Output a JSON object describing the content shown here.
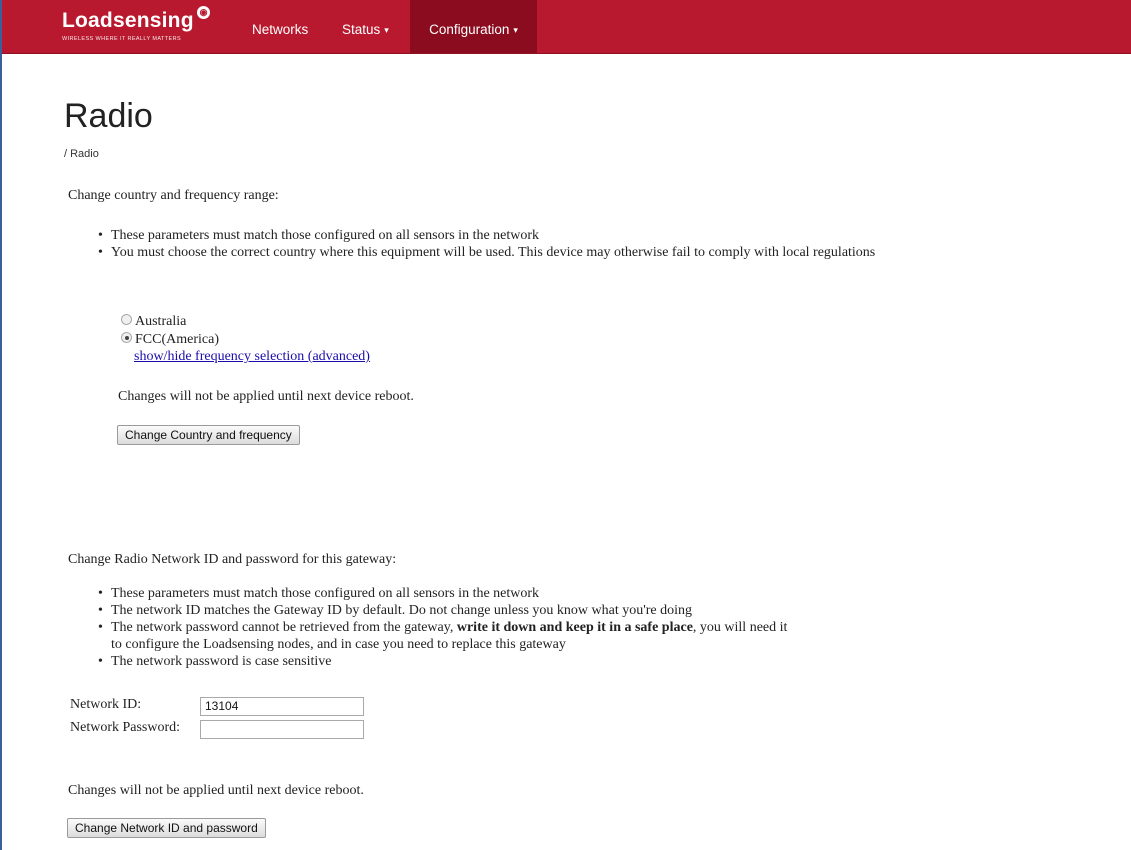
{
  "navbar": {
    "brand_name_bold": "Loadsensing",
    "brand_tagline": "WIRELESS WHERE IT REALLY MATTERS",
    "items": [
      {
        "label": "Networks",
        "has_caret": false,
        "active": false
      },
      {
        "label": "Status",
        "has_caret": true,
        "active": false
      },
      {
        "label": "Configuration",
        "has_caret": true,
        "active": true
      }
    ],
    "caret": "▾",
    "color": "#b8192f",
    "active_color": "#8b0c1f"
  },
  "page": {
    "title": "Radio",
    "breadcrumb": "/ Radio"
  },
  "country_section": {
    "heading": "Change country and frequency range:",
    "bullets": [
      "These parameters must match those configured on all sensors in the network",
      "You must choose the correct country where this equipment will be used. This device may otherwise fail to comply with local regulations"
    ],
    "options": [
      {
        "label": "Australia",
        "checked": false
      },
      {
        "label": "FCC(America)",
        "checked": true
      }
    ],
    "advanced_link": "show/hide frequency selection (advanced)",
    "note": "Changes will not be applied until next device reboot.",
    "button": "Change Country and frequency"
  },
  "network_section": {
    "heading": "Change Radio Network ID and password for this gateway:",
    "bullet1": "These parameters must match those configured on all sensors in the network",
    "bullet2": "The network ID matches the Gateway ID by default. Do not change unless you know what you're doing",
    "bullet3_a": "The network password cannot be retrieved from the gateway, ",
    "bullet3_bold": "write it down and keep it in a safe place",
    "bullet3_b": ", you will need it to configure the Loadsensing nodes, and in case you need to replace this gateway",
    "bullet4": "The network password is case sensitive",
    "network_id_label": "Network ID:",
    "network_id_value": "13104",
    "password_label": "Network Password:",
    "password_value": "",
    "note": "Changes will not be applied until next device reboot.",
    "button": "Change Network ID and password"
  }
}
